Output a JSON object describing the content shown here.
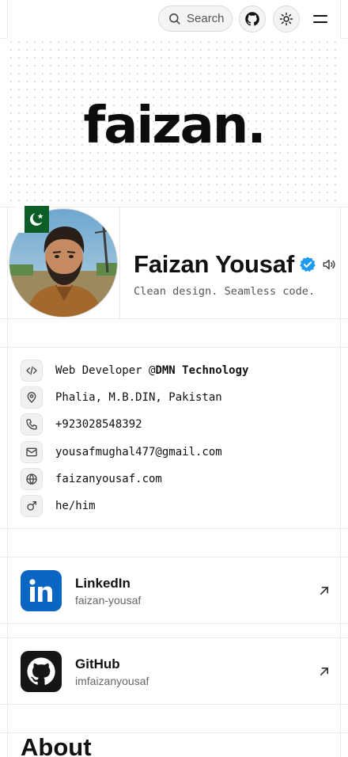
{
  "header": {
    "search_label": "Search",
    "icons": [
      "search-icon",
      "github-icon",
      "sun-icon",
      "menu-icon"
    ]
  },
  "banner": {
    "logo_text": "faizan."
  },
  "profile": {
    "name": "Faizan Yousaf",
    "tagline": "Clean design. Seamless code.",
    "flag": "pakistan-flag",
    "verified_color": "#1d9bf0"
  },
  "info": [
    {
      "icon": "code-icon",
      "text": "Web Developer @",
      "strong": "DMN Technology"
    },
    {
      "icon": "map-pin-icon",
      "text": "Phalia, M.B.DIN, Pakistan"
    },
    {
      "icon": "phone-icon",
      "text": "+923028548392"
    },
    {
      "icon": "mail-icon",
      "text": "yousafmughal477@gmail.com"
    },
    {
      "icon": "globe-icon",
      "text": "faizanyousaf.com"
    },
    {
      "icon": "male-icon",
      "text": "he/him"
    }
  ],
  "social": [
    {
      "name": "LinkedIn",
      "handle": "faizan-yousaf",
      "color": "#0a66c2"
    },
    {
      "name": "GitHub",
      "handle": "imfaizanyousaf",
      "color": "#151515"
    }
  ],
  "about": {
    "title": "About"
  }
}
